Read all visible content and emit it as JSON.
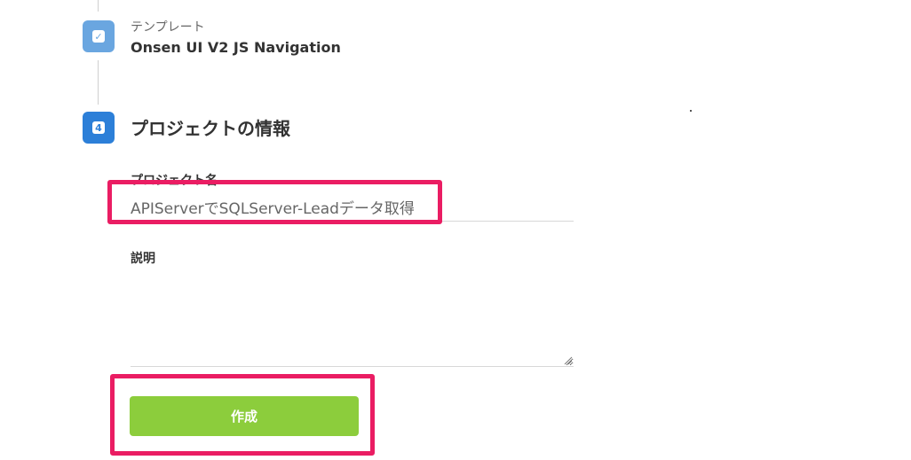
{
  "steps": {
    "template": {
      "icon": "checkmark-icon",
      "badge_glyph": "✓",
      "caption": "テンプレート",
      "value": "Onsen UI V2 JS Navigation"
    },
    "project_info": {
      "number": "4",
      "title": "プロジェクトの情報"
    }
  },
  "form": {
    "name_label": "プロジェクト名",
    "name_value": "APIServerでSQLServer-Leadデータ取得",
    "description_label": "説明",
    "description_value": "",
    "create_label": "作成"
  },
  "colors": {
    "completed_step": "#6aa6e0",
    "current_step": "#2c7fd8",
    "create_button": "#8ccd3c",
    "highlight": "#ea1d63"
  }
}
